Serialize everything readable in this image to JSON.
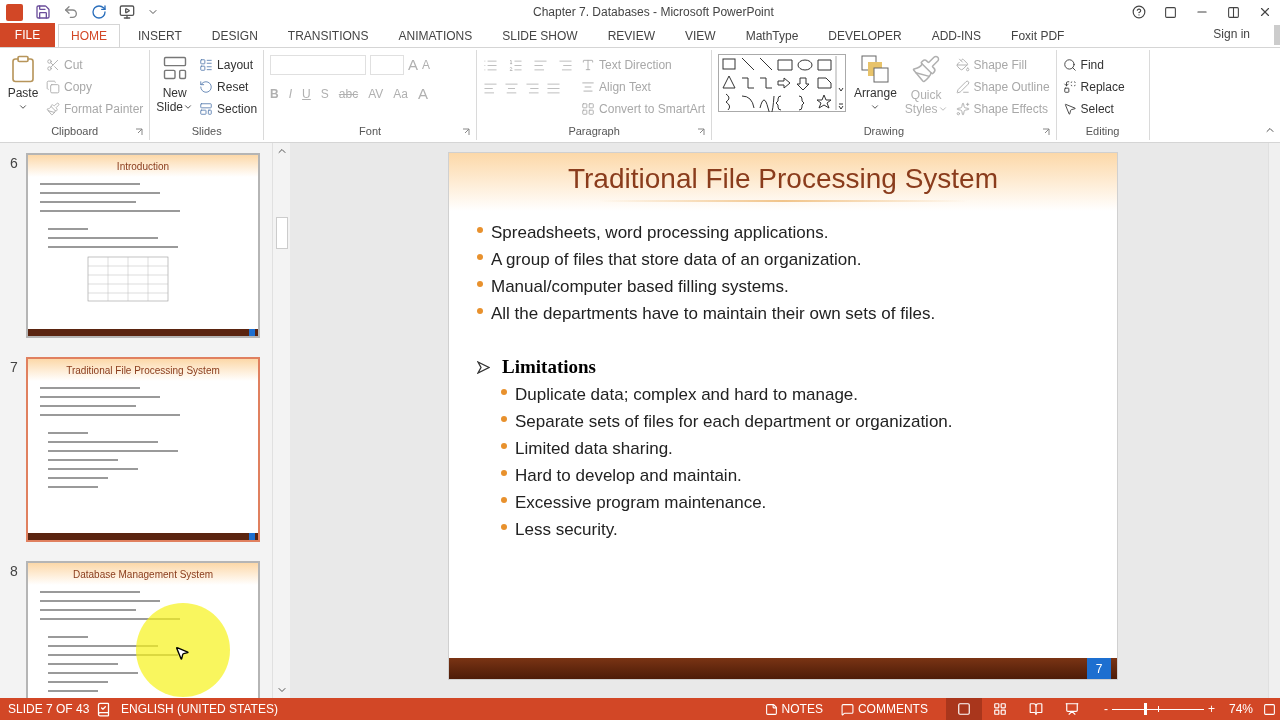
{
  "window": {
    "title": "Chapter 7. Databases - Microsoft PowerPoint",
    "sign_in": "Sign in"
  },
  "tabs": [
    {
      "label": "FILE",
      "kind": "file",
      "selected": false
    },
    {
      "label": "HOME",
      "kind": "tab",
      "selected": true
    },
    {
      "label": "INSERT",
      "kind": "tab",
      "selected": false
    },
    {
      "label": "DESIGN",
      "kind": "tab",
      "selected": false
    },
    {
      "label": "TRANSITIONS",
      "kind": "tab",
      "selected": false
    },
    {
      "label": "ANIMATIONS",
      "kind": "tab",
      "selected": false
    },
    {
      "label": "SLIDE SHOW",
      "kind": "tab",
      "selected": false
    },
    {
      "label": "REVIEW",
      "kind": "tab",
      "selected": false
    },
    {
      "label": "VIEW",
      "kind": "tab",
      "selected": false
    },
    {
      "label": "MathType",
      "kind": "tab",
      "selected": false
    },
    {
      "label": "DEVELOPER",
      "kind": "tab",
      "selected": false
    },
    {
      "label": "ADD-INS",
      "kind": "tab",
      "selected": false
    },
    {
      "label": "Foxit PDF",
      "kind": "tab",
      "selected": false
    }
  ],
  "ribbon": {
    "clipboard": {
      "label": "Clipboard",
      "paste": "Paste",
      "items": [
        {
          "label": "Cut",
          "disabled": true
        },
        {
          "label": "Copy",
          "disabled": true
        },
        {
          "label": "Format Painter",
          "disabled": true
        }
      ]
    },
    "slides": {
      "label": "Slides",
      "new_slide": [
        "New",
        "Slide"
      ],
      "items": [
        {
          "label": "Layout",
          "disabled": false
        },
        {
          "label": "Reset",
          "disabled": false
        },
        {
          "label": "Section",
          "disabled": false
        }
      ]
    },
    "font": {
      "label": "Font",
      "size_buttons": [
        "A",
        "A"
      ],
      "format_buttons": [
        "B",
        "I",
        "U",
        "S",
        "abc",
        "AV",
        "Aa",
        "A"
      ],
      "disabled": true
    },
    "paragraph": {
      "label": "Paragraph",
      "items": [
        {
          "label": "Text Direction",
          "disabled": true
        },
        {
          "label": "Align Text",
          "disabled": true
        },
        {
          "label": "Convert to SmartArt",
          "disabled": true
        }
      ]
    },
    "drawing": {
      "label": "Drawing",
      "arrange": "Arrange",
      "quick_styles": [
        "Quick",
        "Styles"
      ],
      "quick_styles_disabled": true,
      "items": [
        {
          "label": "Shape Fill",
          "disabled": true
        },
        {
          "label": "Shape Outline",
          "disabled": true
        },
        {
          "label": "Shape Effects",
          "disabled": true
        }
      ]
    },
    "editing": {
      "label": "Editing",
      "items": [
        {
          "label": "Find",
          "disabled": false
        },
        {
          "label": "Replace",
          "disabled": false
        },
        {
          "label": "Select",
          "disabled": false
        }
      ]
    }
  },
  "thumbnails": [
    {
      "number": "6",
      "title": "Introduction",
      "kind": "text_table",
      "selected": false,
      "cursor_highlight": false
    },
    {
      "number": "7",
      "title": "Traditional File Processing System",
      "kind": "text",
      "selected": true,
      "cursor_highlight": false
    },
    {
      "number": "8",
      "title": "Database Management System",
      "kind": "text",
      "selected": false,
      "cursor_highlight": true
    }
  ],
  "main_slide": {
    "title": "Traditional File Processing System",
    "page": "7",
    "sections": [
      {
        "items": [
          {
            "kind": "bullet",
            "text": "Spreadsheets, word processing applications."
          },
          {
            "kind": "bullet",
            "text": "A group of files that store data of an organization."
          },
          {
            "kind": "bullet",
            "text": "Manual/computer based filling systems."
          },
          {
            "kind": "bullet",
            "text": "All the departments have to maintain their own sets of files."
          }
        ]
      },
      {
        "items": [
          {
            "kind": "heading",
            "text": "Limitations",
            "children": [
              {
                "kind": "bullet",
                "text": "Duplicate data; complex and hard to manage."
              },
              {
                "kind": "bullet",
                "text": "Separate sets of files for each department or organization."
              },
              {
                "kind": "bullet",
                "text": "Limited data sharing."
              },
              {
                "kind": "bullet",
                "text": "Hard to develop and maintain."
              },
              {
                "kind": "bullet",
                "text": "Excessive program maintenance."
              },
              {
                "kind": "bullet",
                "text": "Less security."
              }
            ]
          }
        ]
      }
    ]
  },
  "status_bar": {
    "slide_info": "SLIDE 7 OF 43",
    "language": "ENGLISH (UNITED STATES)",
    "notes": "NOTES",
    "comments": "COMMENTS",
    "views": [
      {
        "kind": "normal",
        "selected": true
      },
      {
        "kind": "sorter",
        "selected": false
      },
      {
        "kind": "reading",
        "selected": false
      },
      {
        "kind": "slideshow",
        "selected": false
      }
    ],
    "zoom_out": "-",
    "zoom_in": "+",
    "zoom": {
      "level": 0.36
    },
    "zoom_text": "74%"
  }
}
